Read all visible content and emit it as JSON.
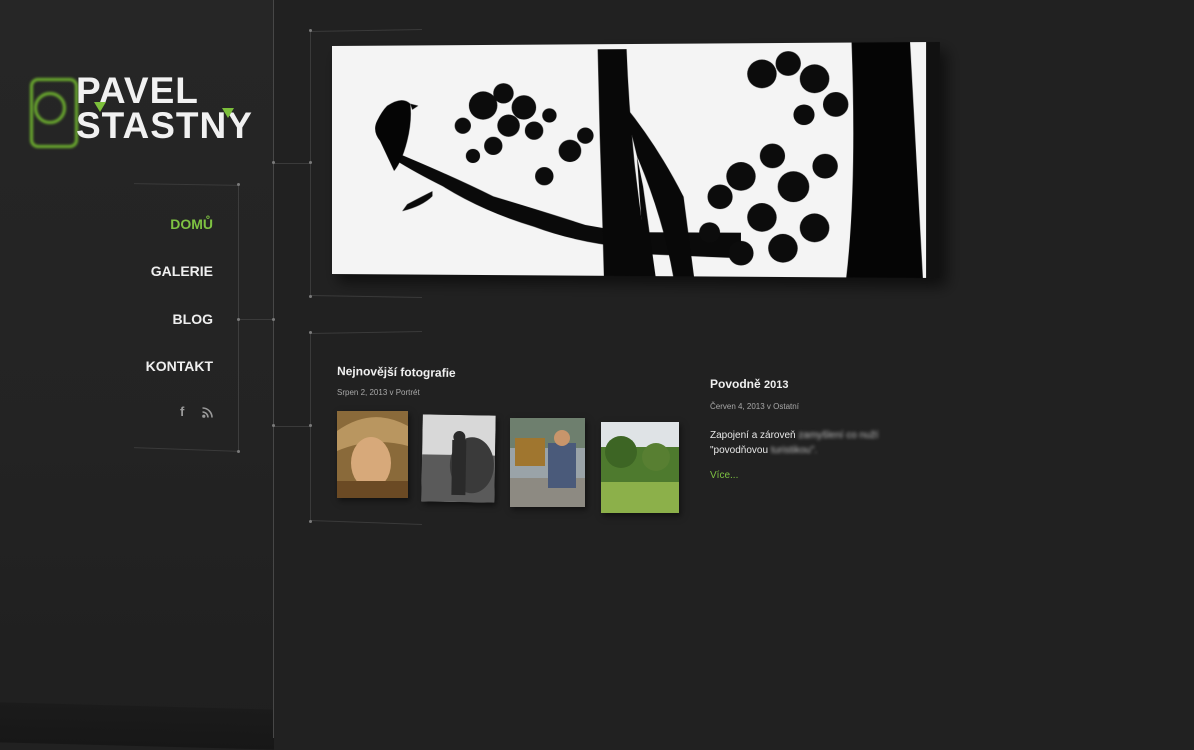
{
  "logo": {
    "line1": "PAVEL",
    "line2": "STASTNY",
    "brand_color": "#7ec242",
    "camera_icon": "camera-outline-icon"
  },
  "nav": {
    "items": [
      {
        "label": "DOMŮ",
        "active": true
      },
      {
        "label": "GALERIE",
        "active": false
      },
      {
        "label": "BLOG",
        "active": false
      },
      {
        "label": "KONTAKT",
        "active": false
      }
    ],
    "social": {
      "facebook_glyph": "f",
      "rss_icon": "rss-icon"
    }
  },
  "hero": {
    "image": "silhouette of eagle on tree branch"
  },
  "latest_photos": {
    "title": "Nejnovější fotografie",
    "meta": "Srpen 2, 2013 v Portrét",
    "thumbs": [
      "portrait of woman in hat",
      "man with hay stack",
      "man in checked shirt in front of tractor",
      "green hillside landscape"
    ]
  },
  "blog_post": {
    "title_word": "Povodně",
    "title_year": "2013",
    "meta": "Červen 4, 2013 v Ostatní",
    "text_sharp_1": "Zapojení a zároveň",
    "text_blur_1": "zamyšlení co nuží",
    "text_sharp_2": "\"povodňovou",
    "text_blur_2": "turistikou\".",
    "more_label": "Více..."
  },
  "colors": {
    "background": "#212121",
    "accent": "#7ec242",
    "text": "#efefef"
  }
}
